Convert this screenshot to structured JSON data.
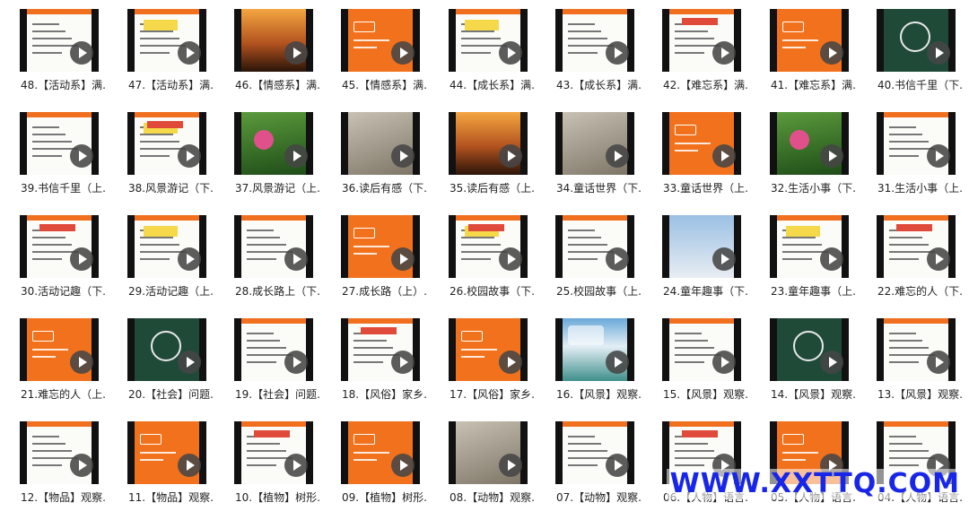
{
  "watermark": "WWW.XXTTQ.COM",
  "videos": [
    {
      "caption": "48.【活动系】满...",
      "style": "white"
    },
    {
      "caption": "47.【活动系】满...",
      "style": "white"
    },
    {
      "caption": "46.【情感系】满...",
      "style": "sunset"
    },
    {
      "caption": "45.【情感系】满...",
      "style": "orange"
    },
    {
      "caption": "44.【成长系】满...",
      "style": "white"
    },
    {
      "caption": "43.【成长系】满...",
      "style": "white"
    },
    {
      "caption": "42.【难忘系】满...",
      "style": "white"
    },
    {
      "caption": "41.【难忘系】满...",
      "style": "orange"
    },
    {
      "caption": "40.书信千里（下...",
      "style": "board"
    },
    {
      "caption": "39.书信千里（上...",
      "style": "white"
    },
    {
      "caption": "38.风景游记（下...",
      "style": "white"
    },
    {
      "caption": "37.风景游记（上...",
      "style": "green"
    },
    {
      "caption": "36.读后有感（下...",
      "style": "photo"
    },
    {
      "caption": "35.读后有感（上...",
      "style": "sunset"
    },
    {
      "caption": "34.童话世界（下...",
      "style": "photo"
    },
    {
      "caption": "33.童话世界（上...",
      "style": "orange"
    },
    {
      "caption": "32.生活小事（下...",
      "style": "green"
    },
    {
      "caption": "31.生活小事（上...",
      "style": "white"
    },
    {
      "caption": "30.活动记趣（下...",
      "style": "white"
    },
    {
      "caption": "29.活动记趣（上...",
      "style": "white"
    },
    {
      "caption": "28.成长路上（下...",
      "style": "white"
    },
    {
      "caption": "27.成长路（上）...",
      "style": "orange"
    },
    {
      "caption": "26.校园故事（下...",
      "style": "white"
    },
    {
      "caption": "25.校园故事（上...",
      "style": "white"
    },
    {
      "caption": "24.童年趣事（下...",
      "style": "sky"
    },
    {
      "caption": "23.童年趣事（上...",
      "style": "white"
    },
    {
      "caption": "22.难忘的人（下...",
      "style": "white"
    },
    {
      "caption": "21.难忘的人（上...",
      "style": "orange"
    },
    {
      "caption": "20.【社会】问题...",
      "style": "board"
    },
    {
      "caption": "19.【社会】问题...",
      "style": "white"
    },
    {
      "caption": "18.【风俗】家乡...",
      "style": "white"
    },
    {
      "caption": "17.【风俗】家乡...",
      "style": "orange"
    },
    {
      "caption": "16.【风景】观察...",
      "style": "lake"
    },
    {
      "caption": "15.【风景】观察...",
      "style": "white"
    },
    {
      "caption": "14.【风景】观察...",
      "style": "board"
    },
    {
      "caption": "13.【风景】观察...",
      "style": "white"
    },
    {
      "caption": "12.【物品】观察...",
      "style": "white"
    },
    {
      "caption": "11.【物品】观察...",
      "style": "orange"
    },
    {
      "caption": "10.【植物】树形...",
      "style": "white"
    },
    {
      "caption": "09.【植物】树形...",
      "style": "orange"
    },
    {
      "caption": "08.【动物】观察...",
      "style": "photo"
    },
    {
      "caption": "07.【动物】观察...",
      "style": "white"
    },
    {
      "caption": "06.【人物】语言...",
      "style": "white"
    },
    {
      "caption": "05.【人物】语言...",
      "style": "orange"
    },
    {
      "caption": "04.【人物】语言...",
      "style": "white"
    }
  ]
}
